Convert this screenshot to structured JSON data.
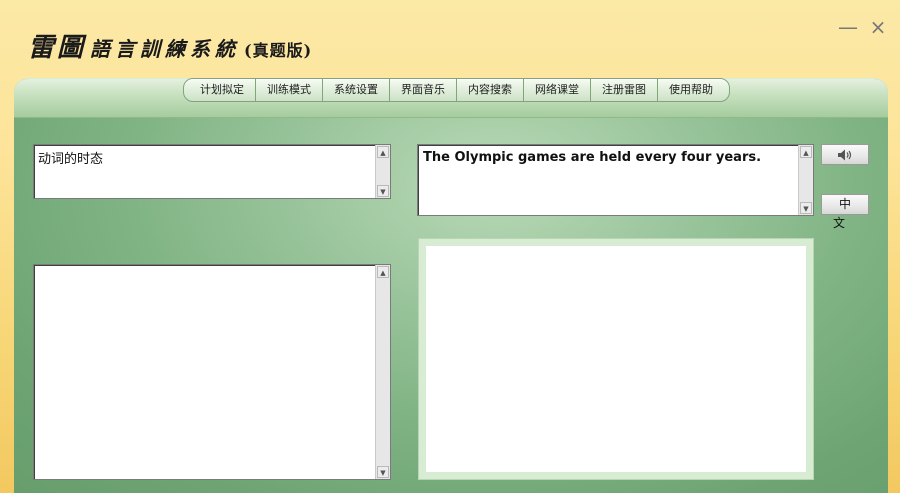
{
  "title": {
    "logo": "雷圖",
    "name": "語言訓練系統",
    "edition": "(真题版)"
  },
  "window_controls": {
    "minimize": "—",
    "close": "×"
  },
  "menu": {
    "tabs": [
      "计划拟定",
      "训练模式",
      "系统设置",
      "界面音乐",
      "内容搜索",
      "网络课堂",
      "注册雷图",
      "使用帮助"
    ]
  },
  "topic_box": {
    "text": "动词的时态"
  },
  "sentence_box": {
    "text": "The Olympic games are held every four years."
  },
  "buttons": {
    "speaker_icon": "speaker-icon",
    "chinese_label": "中文"
  },
  "scroll_glyphs": {
    "up": "▲",
    "down": "▼"
  },
  "colors": {
    "title_bar": "#fde49a",
    "panel_green": "#7fb383",
    "tab_face": "#e0eedb"
  }
}
